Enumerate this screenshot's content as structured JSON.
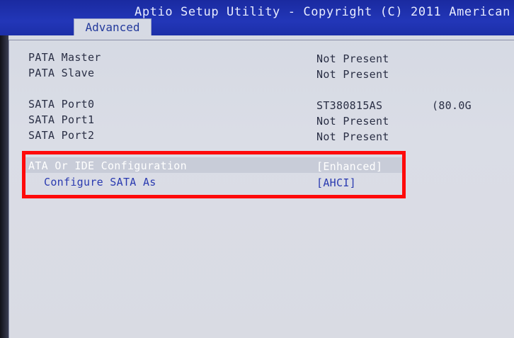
{
  "header": {
    "title": "Aptio Setup Utility - Copyright (C) 2011 American",
    "active_tab": "Advanced"
  },
  "items": [
    {
      "label": "PATA Master",
      "value": "Not Present"
    },
    {
      "label": "PATA Slave",
      "value": "Not Present"
    },
    {
      "label": "SATA Port0",
      "value": "ST380815AS",
      "extra": "(80.0G"
    },
    {
      "label": "SATA Port1",
      "value": "Not Present"
    },
    {
      "label": "SATA Port2",
      "value": "Not Present"
    }
  ],
  "settings": [
    {
      "label": "ATA Or IDE Configuration",
      "value": "[Enhanced]"
    },
    {
      "label": "Configure SATA As",
      "value": "[AHCI]"
    }
  ],
  "colors": {
    "header_bg": "#2236b8",
    "highlight_border": "#ff0a0a",
    "setting_text": "#2a3ab0"
  }
}
